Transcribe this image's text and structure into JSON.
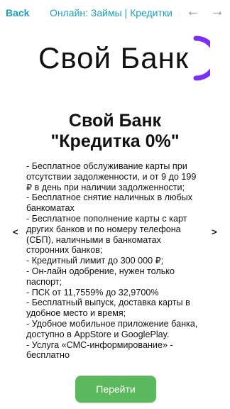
{
  "header": {
    "back_label": "Back",
    "title": "Онлайн: Займы | Кредитки",
    "prev_icon": "←",
    "next_icon": "→"
  },
  "logo": {
    "text": "Свой Банк",
    "arc_color": "#7b2ff7"
  },
  "card": {
    "title_line1": "Свой Банк",
    "title_line2": "\"Кредитка 0%\"",
    "description_lines": [
      "- Бесплатное обслуживание карты при",
      "отсутствии задолженности, и от 9 до 199",
      "₽ в день при наличии задолженности;",
      "- Бесплатное снятие наличных в любых",
      "банкоматах",
      "- Бесплатное пополнение карты с карт",
      "других банков и по номеру телефона",
      "(СБП), наличными в банкоматах",
      "сторонних банков;",
      "- Кредитный лимит до 300 000 ₽;",
      "- Он-лайн одобрение, нужен только",
      "паспорт;",
      "- ПСК от 11,7559% до 32,9700%",
      "- Бесплатный выпуск, доставка карты в",
      "удобное место и время;",
      "- Удобное мобильное приложение банка,",
      "доступно в AppStore и GooglePlay.",
      "- Услуга «СМС-информирование» -",
      "бесплатно"
    ],
    "carousel_prev": "<",
    "carousel_next": ">"
  },
  "action": {
    "button_label": "Перейти",
    "button_color": "#5cb85c"
  },
  "colors": {
    "accent": "#1aa0b8"
  }
}
